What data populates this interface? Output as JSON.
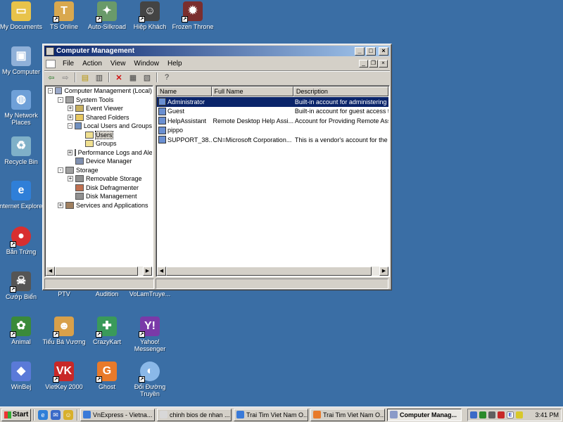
{
  "desktop": {
    "icons": [
      {
        "label": "My Documents",
        "icon": "my-documents-icon",
        "color": "#e8c34a"
      },
      {
        "label": "TS Online",
        "icon": "ts-online-icon",
        "color": "#d9a84e"
      },
      {
        "label": "Auto-Silkroad",
        "icon": "auto-silkroad-icon",
        "color": "#6a9a6a"
      },
      {
        "label": "Hiệp Khách",
        "icon": "hiep-khach-icon",
        "color": "#444444"
      },
      {
        "label": "Frozen Throne",
        "icon": "frozen-throne-icon",
        "color": "#7a2e2e"
      },
      {
        "label": "My Computer",
        "icon": "my-computer-icon",
        "color": "#8fb0d8"
      },
      {
        "label": "My Network Places",
        "icon": "network-places-icon",
        "color": "#6fa0d8"
      },
      {
        "label": "Recycle Bin",
        "icon": "recycle-bin-icon",
        "color": "#7fb0c8"
      },
      {
        "label": "Internet Explorer",
        "icon": "internet-explorer-icon",
        "color": "#2f7fd8"
      },
      {
        "label": "Bắn Trứng",
        "icon": "ban-trung-icon",
        "color": "#d82f2f"
      },
      {
        "label": "Cướp Biển",
        "icon": "cuop-bien-icon",
        "color": "#555555"
      },
      {
        "label": "PTV",
        "icon": "ptv-icon",
        "color": ""
      },
      {
        "label": "Audition",
        "icon": "audition-icon",
        "color": ""
      },
      {
        "label": "VoLamTruye...",
        "icon": "volam-icon",
        "color": ""
      },
      {
        "label": "Animal",
        "icon": "animal-icon",
        "color": "#3a8a3a"
      },
      {
        "label": "Tiểu Bá Vương",
        "icon": "tieu-ba-vuong-icon",
        "color": "#d8a04a"
      },
      {
        "label": "CrazyKart",
        "icon": "crazykart-icon",
        "color": "#3a9a5a"
      },
      {
        "label": "Yahoo! Messenger",
        "icon": "yahoo-messenger-icon",
        "color": "#7a3aa8"
      },
      {
        "label": "WinBej",
        "icon": "winbej-icon",
        "color": "#5a7ad8"
      },
      {
        "label": "VietKey 2000",
        "icon": "vietkey-icon",
        "color": "#c82828"
      },
      {
        "label": "Ghost",
        "icon": "ghost-icon",
        "color": "#e87a2a"
      },
      {
        "label": "Đổi Đường Truyền",
        "icon": "doi-duong-truyen-icon",
        "color": "#8ab8e8"
      }
    ]
  },
  "window": {
    "title": "Computer Management",
    "menu": [
      "File",
      "Action",
      "View",
      "Window",
      "Help"
    ],
    "toolbar_icons": [
      "back-icon",
      "forward-icon",
      "up-folder-icon",
      "show-hide-tree-icon",
      "delete-icon",
      "properties-icon",
      "export-list-icon",
      "help-icon"
    ],
    "tree": [
      {
        "label": "Computer Management (Local)",
        "level": 0,
        "exp": "-",
        "icon_color": "#9aa8c8"
      },
      {
        "label": "System Tools",
        "level": 1,
        "exp": "-",
        "icon_color": "#a0a0a0"
      },
      {
        "label": "Event Viewer",
        "level": 2,
        "exp": "+",
        "icon_color": "#c8b060"
      },
      {
        "label": "Shared Folders",
        "level": 2,
        "exp": "+",
        "icon_color": "#e8c860"
      },
      {
        "label": "Local Users and Groups",
        "level": 2,
        "exp": "-",
        "icon_color": "#7090c0"
      },
      {
        "label": "Users",
        "level": 3,
        "exp": "",
        "icon_color": "#f0e090",
        "selected": true
      },
      {
        "label": "Groups",
        "level": 3,
        "exp": "",
        "icon_color": "#f0e090"
      },
      {
        "label": "Performance Logs and Alerts",
        "level": 2,
        "exp": "+",
        "icon_color": "#70a070"
      },
      {
        "label": "Device Manager",
        "level": 2,
        "exp": "",
        "icon_color": "#8090b0"
      },
      {
        "label": "Storage",
        "level": 1,
        "exp": "-",
        "icon_color": "#a0a0a0"
      },
      {
        "label": "Removable Storage",
        "level": 2,
        "exp": "+",
        "icon_color": "#909090"
      },
      {
        "label": "Disk Defragmenter",
        "level": 2,
        "exp": "",
        "icon_color": "#c07050"
      },
      {
        "label": "Disk Management",
        "level": 2,
        "exp": "",
        "icon_color": "#909090"
      },
      {
        "label": "Services and Applications",
        "level": 1,
        "exp": "+",
        "icon_color": "#a08060"
      }
    ],
    "list": {
      "columns": [
        "Name",
        "Full Name",
        "Description"
      ],
      "rows": [
        {
          "name": "Administrator",
          "full_name": "",
          "description": "Built-in account for administering th",
          "selected": true
        },
        {
          "name": "Guest",
          "full_name": "",
          "description": "Built-in account for guest access to"
        },
        {
          "name": "HelpAssistant",
          "full_name": "Remote Desktop Help Assi...",
          "description": "Account for Providing Remote Assi"
        },
        {
          "name": "pippo",
          "full_name": "",
          "description": ""
        },
        {
          "name": "SUPPORT_38...",
          "full_name": "CN=Microsoft Corporation...",
          "description": "This is a vendor's account for the H"
        }
      ]
    }
  },
  "taskbar": {
    "start_label": "Start",
    "quick_launch": [
      "ie-icon",
      "outlook-icon",
      "yahoo-icon"
    ],
    "buttons": [
      {
        "label": "VnExpress - Vietna...",
        "icon": "ie-page-icon",
        "color": "#3a7ad8"
      },
      {
        "label": "chinh bios de nhan ...",
        "icon": "notepad-icon",
        "color": "#d8d8d8"
      },
      {
        "label": "Trai Tim Viet Nam O...",
        "icon": "ie-page-icon",
        "color": "#3a7ad8"
      },
      {
        "label": "Trai Tim Viet Nam O...",
        "icon": "firefox-icon",
        "color": "#e87a2a"
      },
      {
        "label": "Computer Manag...",
        "icon": "computer-management-icon",
        "color": "#8a9ac8",
        "active": true
      }
    ],
    "tray_icons": [
      "network-tray-icon",
      "messenger-tray-icon",
      "volume-tray-icon",
      "antivirus-tray-icon",
      "vietkey-tray-icon",
      "security-tray-icon"
    ],
    "tray_letter": "E",
    "clock": "3:41 PM"
  }
}
